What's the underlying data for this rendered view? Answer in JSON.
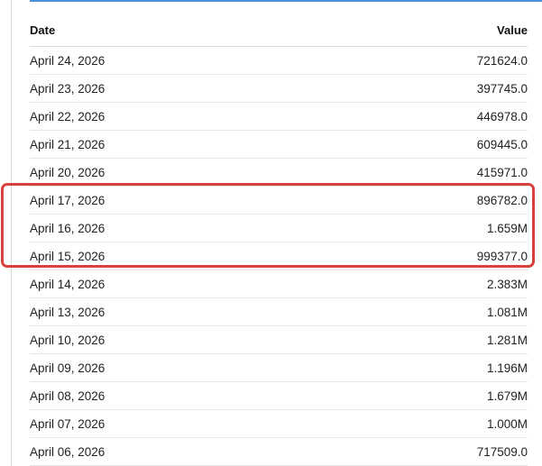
{
  "table": {
    "headers": {
      "date": "Date",
      "value": "Value"
    },
    "rows": [
      {
        "date": "April 24, 2026",
        "value": "721624.0"
      },
      {
        "date": "April 23, 2026",
        "value": "397745.0"
      },
      {
        "date": "April 22, 2026",
        "value": "446978.0"
      },
      {
        "date": "April 21, 2026",
        "value": "609445.0"
      },
      {
        "date": "April 20, 2026",
        "value": "415971.0"
      },
      {
        "date": "April 17, 2026",
        "value": "896782.0"
      },
      {
        "date": "April 16, 2026",
        "value": "1.659M"
      },
      {
        "date": "April 15, 2026",
        "value": "999377.0"
      },
      {
        "date": "April 14, 2026",
        "value": "2.383M"
      },
      {
        "date": "April 13, 2026",
        "value": "1.081M"
      },
      {
        "date": "April 10, 2026",
        "value": "1.281M"
      },
      {
        "date": "April 09, 2026",
        "value": "1.196M"
      },
      {
        "date": "April 08, 2026",
        "value": "1.679M"
      },
      {
        "date": "April 07, 2026",
        "value": "1.000M"
      },
      {
        "date": "April 06, 2026",
        "value": "717509.0"
      }
    ]
  },
  "highlight": {
    "color": "#d94040",
    "rows": [
      "April 17, 2026",
      "April 16, 2026",
      "April 15, 2026"
    ]
  },
  "accent_color": "#4a90d9"
}
